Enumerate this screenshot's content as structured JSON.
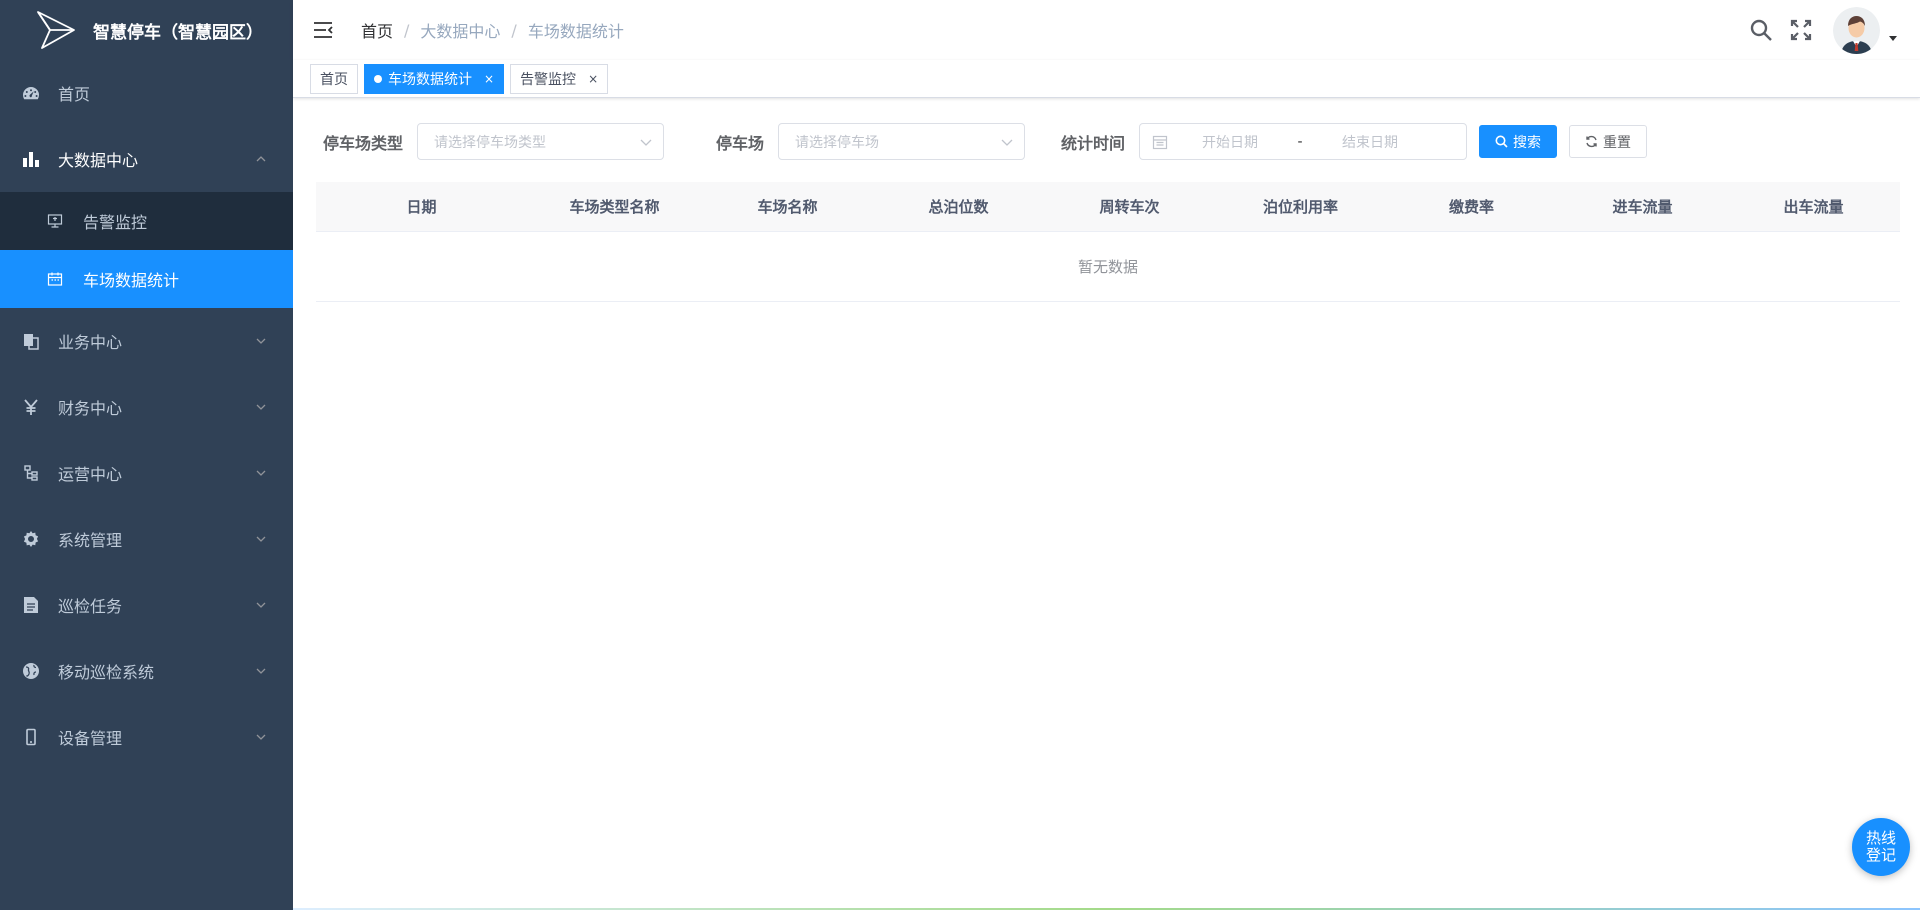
{
  "app": {
    "title": "智慧停车（智慧园区）",
    "colors": {
      "sidebar": "#304156",
      "accent": "#1890ff"
    }
  },
  "sidebar": {
    "home": {
      "label": "首页",
      "icon": "dashboard-icon"
    },
    "bigdata": {
      "label": "大数据中心",
      "icon": "bar-chart-icon"
    },
    "bigdata_sub": [
      {
        "label": "告警监控",
        "icon": "monitor-icon"
      },
      {
        "label": "车场数据统计",
        "icon": "calendar-icon"
      }
    ],
    "items": [
      {
        "label": "业务中心",
        "icon": "copy-icon"
      },
      {
        "label": "财务中心",
        "icon": "yen-icon"
      },
      {
        "label": "运营中心",
        "icon": "tree-icon"
      },
      {
        "label": "系统管理",
        "icon": "gear-icon"
      },
      {
        "label": "巡检任务",
        "icon": "document-icon"
      },
      {
        "label": "移动巡检系统",
        "icon": "globe-icon"
      },
      {
        "label": "设备管理",
        "icon": "phone-icon"
      }
    ]
  },
  "header": {
    "breadcrumb": [
      "首页",
      "大数据中心",
      "车场数据统计"
    ],
    "separator": "/"
  },
  "tags": [
    {
      "label": "首页"
    },
    {
      "label": "车场数据统计",
      "close": "×"
    },
    {
      "label": "告警监控",
      "close": "×"
    }
  ],
  "filters": {
    "type_label": "停车场类型",
    "type_placeholder": "请选择停车场类型",
    "lot_label": "停车场",
    "lot_placeholder": "请选择停车场",
    "time_label": "统计时间",
    "start_placeholder": "开始日期",
    "range_sep": "-",
    "end_placeholder": "结束日期",
    "search_label": "搜索",
    "reset_label": "重置"
  },
  "table": {
    "columns": [
      "日期",
      "车场类型名称",
      "车场名称",
      "总泊位数",
      "周转车次",
      "泊位利用率",
      "缴费率",
      "进车流量",
      "出车流量"
    ],
    "rows": [],
    "empty_text": "暂无数据"
  },
  "hotline": {
    "line1": "热线",
    "line2": "登记"
  }
}
